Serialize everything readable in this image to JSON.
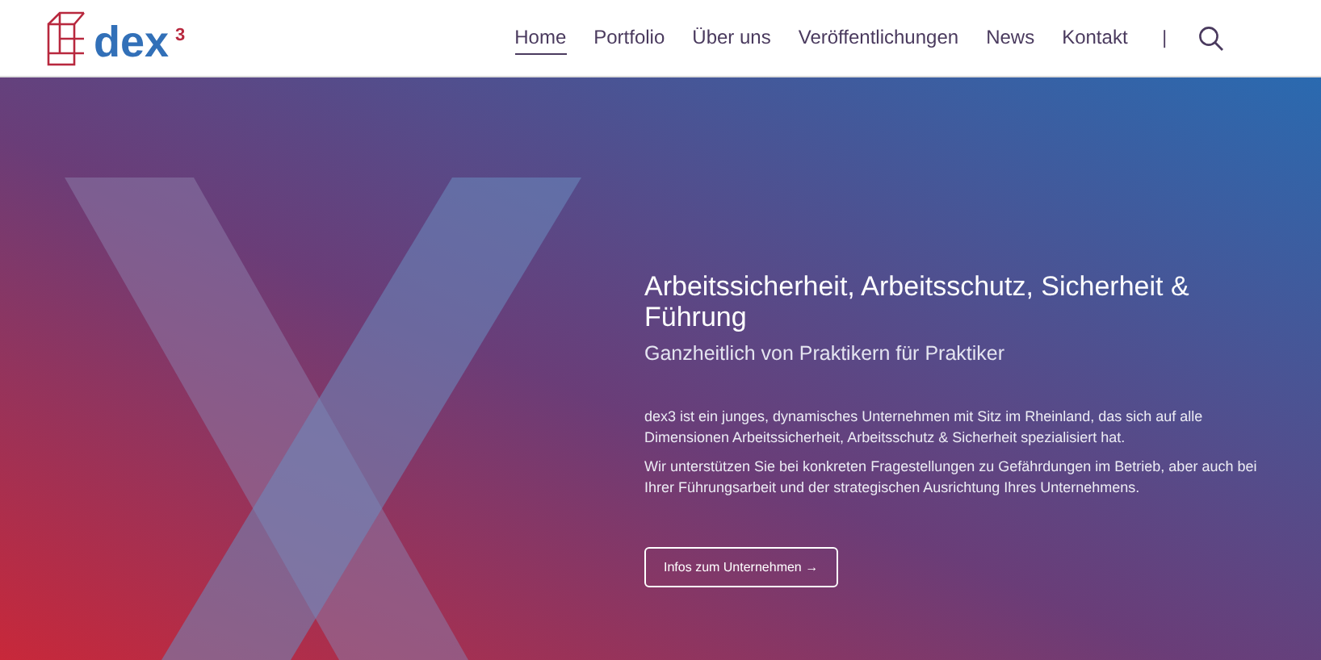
{
  "header": {
    "logo": {
      "name": "dex",
      "superscript": "3"
    },
    "nav": [
      {
        "label": "Home",
        "selected": true
      },
      {
        "label": "Portfolio",
        "selected": false
      },
      {
        "label": "Über uns",
        "selected": false
      },
      {
        "label": "Veröffentlichungen",
        "selected": false
      },
      {
        "label": "News",
        "selected": false
      },
      {
        "label": "Kontakt",
        "selected": false
      }
    ],
    "separator": "|"
  },
  "hero": {
    "title": "Arbeitssicherheit, Arbeitsschutz, Sicherheit & Führung",
    "subtitle": "Ganzheitlich von Praktikern für Praktiker",
    "paragraphs": [
      "dex3 ist ein junges, dynamisches Unternehmen mit Sitz im Rheinland, das sich auf alle Dimensionen Arbeitssicherheit, Arbeitsschutz & Sicherheit spezialisiert hat.",
      "Wir unterstützen Sie bei konkreten Fragestellungen zu Gefährdungen im Betrieb, aber auch bei Ihrer Führungsarbeit und der strategischen Ausrichtung Ihres Unternehmens."
    ],
    "button": "Infos zum Unternehmen →"
  }
}
